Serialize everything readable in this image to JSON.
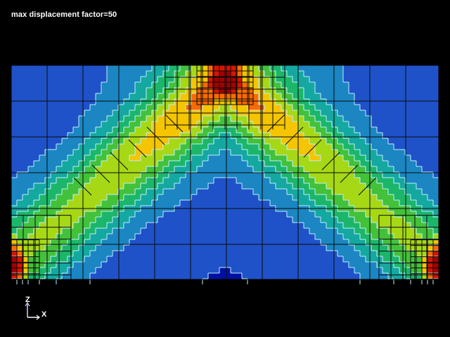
{
  "title": "max displacement factor=50",
  "triad": {
    "vertical_axis": "Z",
    "horizontal_axis": "X"
  },
  "colors": {
    "background": "#000000",
    "title_text": "#ffffff",
    "mesh_lines": "#0a0a0a",
    "contour_lines": "#bfeeff",
    "colormap": [
      "#0010a0",
      "#1f52c8",
      "#1b86c2",
      "#14a8a0",
      "#1cb66a",
      "#43c13a",
      "#a6d816",
      "#f4c500",
      "#ff6a00",
      "#d71400",
      "#a30000"
    ],
    "triad_z": "#cfd6ff",
    "triad_x": "#ffffff"
  },
  "field": {
    "hot_spots": [
      {
        "name": "top-center",
        "u": 0.5,
        "v": 0.07,
        "sx": 0.06,
        "sy": 0.12,
        "amp": 1.0
      },
      {
        "name": "bottom-left",
        "u": 0.0,
        "v": 0.93,
        "sx": 0.04,
        "sy": 0.13,
        "amp": 1.0
      },
      {
        "name": "bottom-right",
        "u": 1.0,
        "v": 0.93,
        "sx": 0.04,
        "sy": 0.13,
        "amp": 1.0
      }
    ],
    "arch_level": 0.55
  }
}
